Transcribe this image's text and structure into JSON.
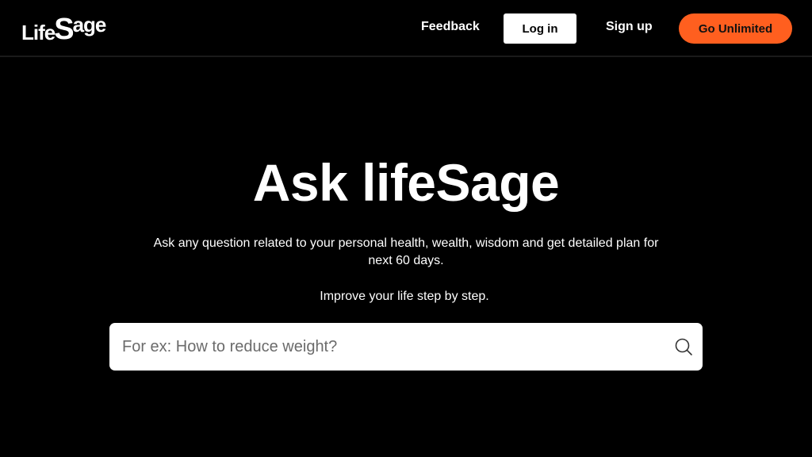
{
  "header": {
    "logo": {
      "part_a": "Life",
      "part_b": "S",
      "part_c": "age"
    },
    "nav": {
      "feedback_label": "Feedback",
      "login_label": "Log in",
      "signup_label": "Sign up",
      "unlimited_label": "Go Unlimited"
    }
  },
  "hero": {
    "title": "Ask lifeSage",
    "description": "Ask any question related to your personal health, wealth, wisdom and get detailed plan for next 60 days.",
    "subtitle": "Improve your life step by step."
  },
  "search": {
    "value": "",
    "placeholder": "For ex: How to reduce weight?",
    "icon": "search-icon"
  },
  "colors": {
    "background": "#000000",
    "accent": "#ff5f1f",
    "text": "#ffffff",
    "search_bg": "#ffffff"
  }
}
